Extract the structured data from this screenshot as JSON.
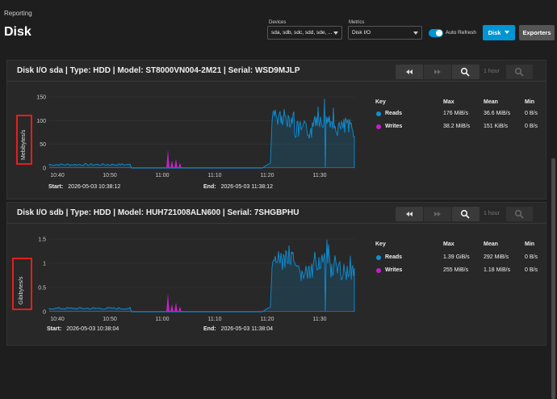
{
  "page": {
    "breadcrumb": "Reporting",
    "title": "Disk"
  },
  "filters": {
    "devices_label": "Devices",
    "devices_value": "sda, sdb, sdc, sdd, sde, ...",
    "metrics_label": "Metrics",
    "metrics_value": "Disk I/O",
    "auto_refresh_label": "Auto Refresh",
    "auto_refresh_on": true,
    "disk_button": "Disk",
    "exporters_button": "Exporters"
  },
  "colors": {
    "reads": "#0e8fd6",
    "writes": "#c51fc9",
    "accent": "#0095d5"
  },
  "time_range_label": "1 hour",
  "legend_headers": {
    "key": "Key",
    "max": "Max",
    "mean": "Mean",
    "min": "Min"
  },
  "cards": [
    {
      "title": "Disk I/O sda | Type: HDD | Model: ST8000VN004-2M21 | Serial: WSD9MJLP",
      "y_label": "Mebibytes/s",
      "y_ticks": [
        "150",
        "100",
        "50",
        "0"
      ],
      "x_ticks": [
        "10:40",
        "10:50",
        "11:00",
        "11:10",
        "11:20",
        "11:30"
      ],
      "start_label": "Start:",
      "start_value": "2026-05-03 10:38:12",
      "end_label": "End:",
      "end_value": "2026-05-03 11:38:12",
      "legend": [
        {
          "key": "Reads",
          "max": "176 MiB/s",
          "mean": "36.6 MiB/s",
          "min": "0 B/s"
        },
        {
          "key": "Writes",
          "max": "38.2 MiB/s",
          "mean": "151 KiB/s",
          "min": "0 B/s"
        }
      ]
    },
    {
      "title": "Disk I/O sdb | Type: HDD | Model: HUH721008ALN600 | Serial: 7SHGBPHU",
      "y_label": "Gibibytes/s",
      "y_ticks": [
        "1.5",
        "1",
        "0.5",
        "0"
      ],
      "x_ticks": [
        "10:40",
        "10:50",
        "11:00",
        "11:10",
        "11:20",
        "11:30"
      ],
      "start_label": "Start:",
      "start_value": "2026-05-03 10:38:04",
      "end_label": "End:",
      "end_value": "2026-05-03 11:38:04",
      "legend": [
        {
          "key": "Reads",
          "max": "1.39 GiB/s",
          "mean": "292 MiB/s",
          "min": "0 B/s"
        },
        {
          "key": "Writes",
          "max": "255 MiB/s",
          "mean": "1.18 MiB/s",
          "min": "0 B/s"
        }
      ]
    }
  ]
}
